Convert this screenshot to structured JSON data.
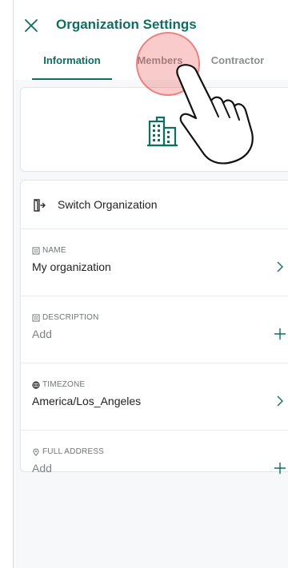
{
  "header": {
    "title": "Organization Settings"
  },
  "tabs": [
    {
      "label": "Information",
      "active": true
    },
    {
      "label": "Members",
      "active": false
    },
    {
      "label": "Contractor",
      "active": false
    }
  ],
  "organization": {
    "switch_label": "Switch Organization",
    "fields": [
      {
        "label": "NAME",
        "value": "My organization",
        "action": "chevron-right-icon"
      },
      {
        "label": "DESCRIPTION",
        "value": "Add",
        "action": "plus-icon"
      },
      {
        "label": "TIMEZONE",
        "value": "America/Los_Angeles",
        "action": "chevron-right-icon"
      },
      {
        "label": "FULL ADDRESS",
        "value": "Add",
        "action": "plus-icon"
      }
    ]
  },
  "colors": {
    "accent": "#0f6e62",
    "tab_inactive": "#8a8f93",
    "background": "#f6f8f9",
    "tap_indicator": "#ec5454"
  }
}
